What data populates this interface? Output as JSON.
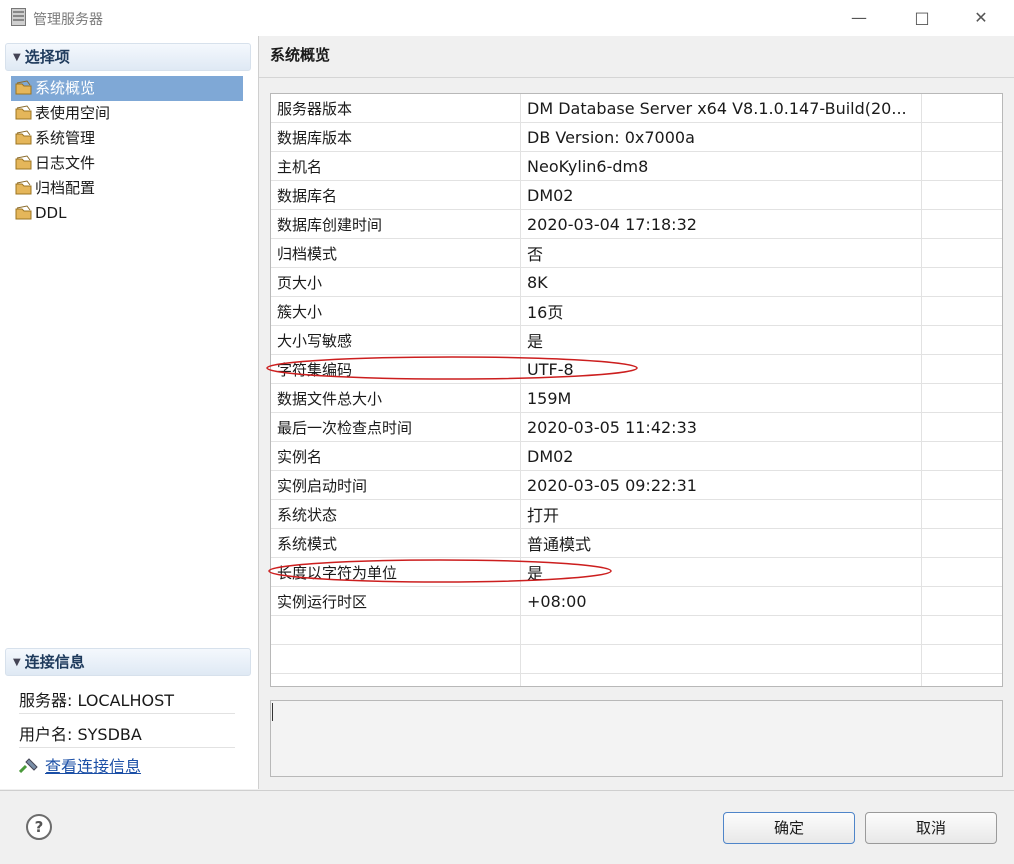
{
  "window": {
    "title": "管理服务器"
  },
  "left": {
    "options_header": "选择项",
    "nav_items": [
      {
        "label": "系统概览",
        "selected": true
      },
      {
        "label": "表使用空间",
        "selected": false
      },
      {
        "label": "系统管理",
        "selected": false
      },
      {
        "label": "日志文件",
        "selected": false
      },
      {
        "label": "归档配置",
        "selected": false
      },
      {
        "label": "DDL",
        "selected": false
      }
    ],
    "connection_header": "连接信息",
    "server_line": "服务器: LOCALHOST",
    "user_line": "用户名: SYSDBA",
    "view_link": "查看连接信息"
  },
  "main": {
    "header": "系统概览",
    "rows": [
      {
        "name": "服务器版本",
        "value": "DM Database Server x64 V8.1.0.147-Build(20..."
      },
      {
        "name": "数据库版本",
        "value": "DB Version: 0x7000a"
      },
      {
        "name": "主机名",
        "value": "NeoKylin6-dm8"
      },
      {
        "name": "数据库名",
        "value": "DM02"
      },
      {
        "name": "数据库创建时间",
        "value": "2020-03-04 17:18:32"
      },
      {
        "name": "归档模式",
        "value": "否"
      },
      {
        "name": "页大小",
        "value": "8K"
      },
      {
        "name": "簇大小",
        "value": "16页"
      },
      {
        "name": "大小写敏感",
        "value": "是"
      },
      {
        "name": "字符集编码",
        "value": "UTF-8"
      },
      {
        "name": "数据文件总大小",
        "value": "159M"
      },
      {
        "name": "最后一次检查点时间",
        "value": "2020-03-05 11:42:33"
      },
      {
        "name": "实例名",
        "value": "DM02"
      },
      {
        "name": "实例启动时间",
        "value": "2020-03-05 09:22:31"
      },
      {
        "name": "系统状态",
        "value": "打开"
      },
      {
        "name": "系统模式",
        "value": "普通模式"
      },
      {
        "name": "长度以字符为单位",
        "value": "是"
      },
      {
        "name": "实例运行时区",
        "value": "+08:00"
      },
      {
        "name": "",
        "value": ""
      },
      {
        "name": "",
        "value": ""
      },
      {
        "name": "",
        "value": ""
      }
    ],
    "highlighted_rows": [
      "字符集编码",
      "长度以字符为单位"
    ]
  },
  "footer": {
    "ok_label": "确定",
    "cancel_label": "取消",
    "help_glyph": "?"
  },
  "colors": {
    "selection": "#7fa8d6",
    "annotation": "#cc1e1e",
    "link": "#1b4fa6"
  }
}
